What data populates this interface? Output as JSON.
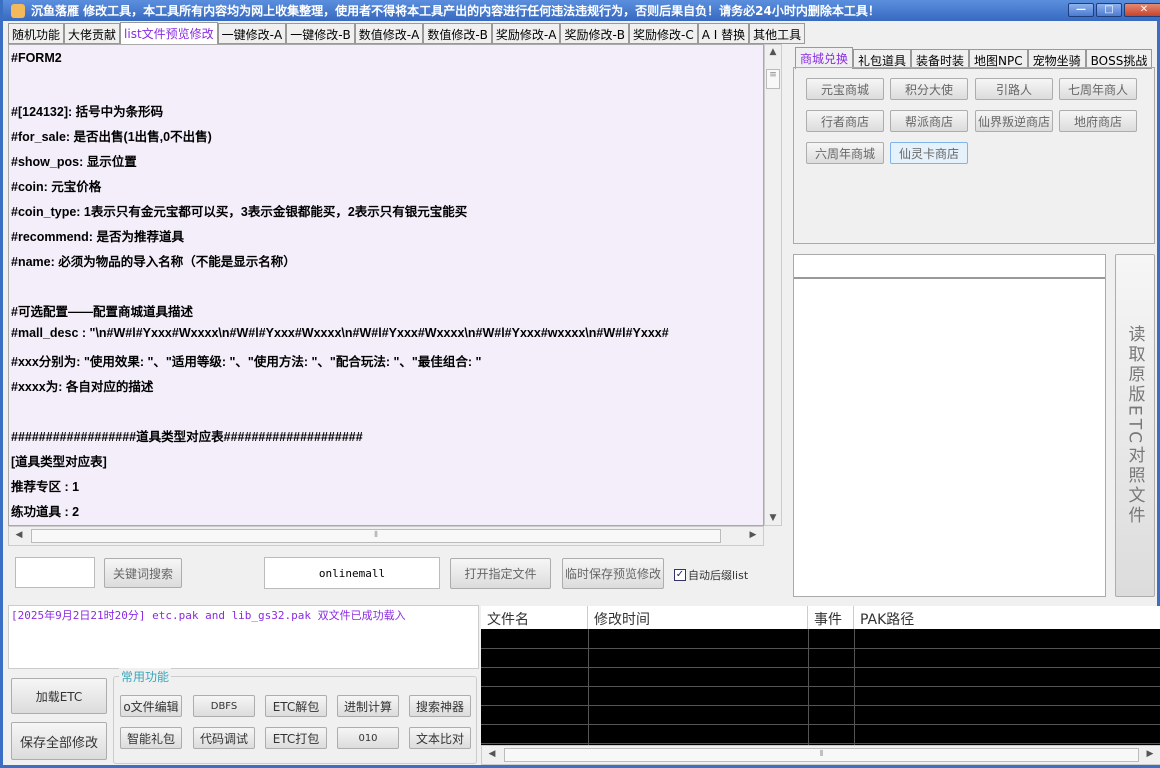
{
  "title": "沉鱼落雁   修改工具，本工具所有内容均为网上收集整理，使用者不得将本工具产出的内容进行任何违法违规行为，否则后果自负！请务必24小时内删除本工具！",
  "window_buttons": {
    "minimize": "—",
    "maximize": "□",
    "close": "✕"
  },
  "tabs": [
    "随机功能",
    "大佬贡献",
    "list文件预览修改",
    "一键修改-A",
    "一键修改-B",
    "数值修改-A",
    "数值修改-B",
    "奖励修改-A",
    "奖励修改-B",
    "奖励修改-C",
    "A I 替换",
    "其他工具"
  ],
  "editor_lines": [
    "#FORM2",
    "",
    "#[124132]:  括号中为条形码",
    "#for_sale:    是否出售(1出售,0不出售)",
    "#show_pos:    显示位置",
    "#coin:        元宝价格",
    "#coin_type:    1表示只有金元宝都可以买，3表示金银都能买，2表示只有银元宝能买",
    "#recommend:    是否为推荐道具",
    "#name:        必须为物品的导入名称（不能是显示名称）",
    "",
    "#可选配置——配置商城道具描述",
    "#mall_desc : \"\\n#W#l#Yxxx#Wxxxx\\n#W#l#Yxxx#Wxxxx\\n#W#l#Yxxx#Wxxxx\\n#W#l#Yxxx#wxxxx\\n#W#l#Yxxx#",
    "#xxx分别为: \"使用效果: \"、\"适用等级: \"、\"使用方法: \"、\"配合玩法: \"、\"最佳组合: \"",
    "#xxxx为:  各自对应的描述",
    "",
    "##################道具类型对应表####################",
    "[道具类型对应表]",
    "推荐专区 : 1",
    "练功道具 : 2"
  ],
  "search": {
    "keyword_value": "",
    "search_label": "关键词搜索",
    "file_value": "onlinemall",
    "open_label": "打开指定文件",
    "save_preview_label": "临时保存预览修改",
    "auto_suffix_label": "自动后缀list",
    "auto_suffix_checked": true
  },
  "right_tabs": [
    "商城兑换",
    "礼包道具",
    "装备时装",
    "地图NPC",
    "宠物坐骑",
    "BOSS挑战"
  ],
  "shop_buttons": [
    "元宝商城",
    "积分大使",
    "引路人",
    "七周年商人",
    "行者商店",
    "帮派商店",
    "仙界叛逆商店",
    "地府商店",
    "六周年商城",
    "仙灵卡商店"
  ],
  "read_button": "读取原版ETC对照文件",
  "log": "[2025年9月2日21时20分]  etc.pak and lib_gs32.pak 双文件已成功载入",
  "load_etc": "加载ETC",
  "save_all": "保存全部修改",
  "group_label": "常用功能",
  "tools": [
    "o文件编辑",
    "DBFS",
    "ETC解包",
    "进制计算",
    "搜索神器",
    "智能礼包",
    "代码调试",
    "ETC打包",
    "010",
    "文本比对"
  ],
  "grid_headers": [
    "文件名",
    "修改时间",
    "事件",
    "PAK路径"
  ],
  "scroll": {
    "thumb": "≡",
    "h_thumb": "⦀"
  }
}
